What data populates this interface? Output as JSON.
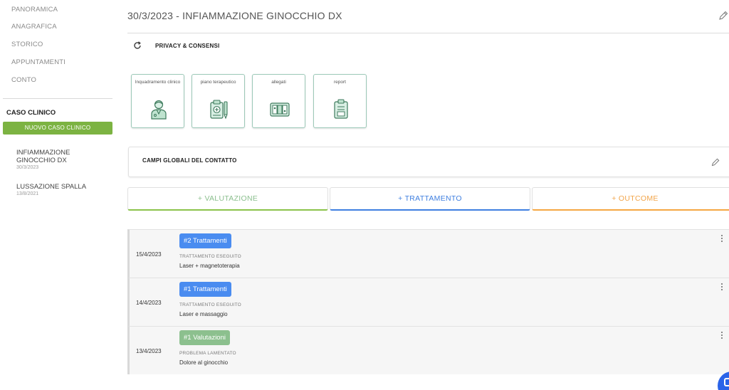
{
  "sidebar": {
    "nav": [
      "PANORAMICA",
      "ANAGRAFICA",
      "STORICO",
      "APPUNTAMENTI",
      "CONTO"
    ],
    "case_heading": "CASO CLINICO",
    "new_case_label": "NUOVO CASO CLINICO",
    "cases": [
      {
        "title": "INFIAMMAZIONE GINOCCHIO DX",
        "date": "30/3/2023"
      },
      {
        "title": "LUSSAZIONE SPALLA",
        "date": "13/8/2021"
      }
    ]
  },
  "header": {
    "title": "30/3/2023 - INFIAMMAZIONE GINOCCHIO DX",
    "privacy_label": "PRIVACY & CONSENSI"
  },
  "cards": [
    {
      "label": "Inquadramento clinico",
      "icon": "doctor-icon"
    },
    {
      "label": "piano terapeutico",
      "icon": "therapy-plan-icon"
    },
    {
      "label": "allegati",
      "icon": "attachments-icon"
    },
    {
      "label": "report",
      "icon": "report-clipboard-icon"
    }
  ],
  "global_fields": {
    "label": "CAMPI GLOBALI DEL CONTATTO"
  },
  "tabs": {
    "valutazione": "+ VALUTAZIONE",
    "trattamento": "+ TRATTAMENTO",
    "outcome": "+ OUTCOME"
  },
  "timeline": [
    {
      "date": "15/4/2023",
      "badge": "#2 Trattamenti",
      "badge_color": "#4a8cf0",
      "type": "TRATTAMENTO ESEGUITO",
      "desc": "Laser + magnetoterapia"
    },
    {
      "date": "14/4/2023",
      "badge": "#1 Trattamenti",
      "badge_color": "#4a8cf0",
      "type": "TRATTAMENTO ESEGUITO",
      "desc": "Laser e massaggio"
    },
    {
      "date": "13/4/2023",
      "badge": "#1 Valutazioni",
      "badge_color": "#8cc08e",
      "type": "PROBLEMA LAMENTATO",
      "desc": "Dolore al ginocchio"
    }
  ],
  "colors": {
    "green": "#7cb342",
    "blue": "#3f7fe0",
    "orange": "#f5a742",
    "card_border": "#9cc9b8"
  }
}
